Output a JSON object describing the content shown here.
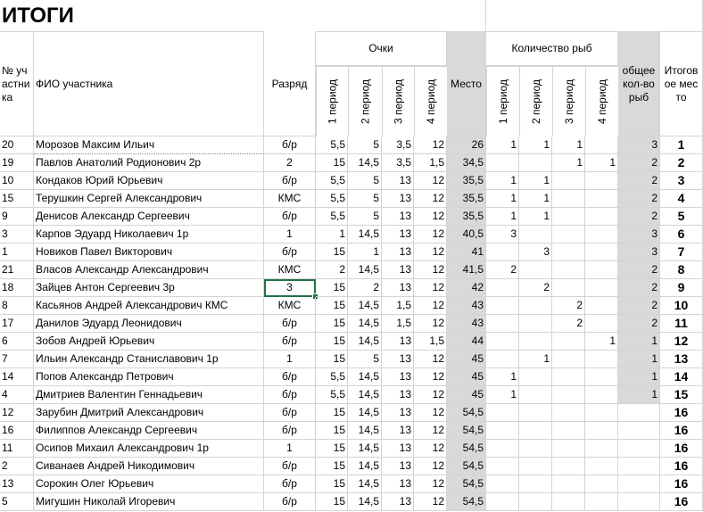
{
  "title": "ИТОГИ",
  "headers": {
    "num": "№ участника",
    "name": "ФИО участника",
    "rank": "Разряд",
    "points_group": "Очки",
    "points_cols": [
      "1 период",
      "2 период",
      "3 период",
      "4 период"
    ],
    "place": "Место",
    "fish_group": "Количество рыб",
    "fish_cols": [
      "1 период",
      "2 период",
      "3 период",
      "4 период"
    ],
    "total_fish": "общее кол-во рыб",
    "final_place": "Итоговое место"
  },
  "rows": [
    {
      "num": "20",
      "name": "Морозов Максим Ильич",
      "rank": "б/р",
      "p": [
        "5,5",
        "5",
        "3,5",
        "12"
      ],
      "place": "26",
      "f": [
        "1",
        "1",
        "1",
        ""
      ],
      "total": "3",
      "final": "1"
    },
    {
      "num": "19",
      "name": "Павлов Анатолий Родионович 2р",
      "rank": "2",
      "p": [
        "15",
        "14,5",
        "3,5",
        "1,5"
      ],
      "place": "34,5",
      "f": [
        "",
        "",
        "1",
        "1"
      ],
      "total": "2",
      "final": "2"
    },
    {
      "num": "10",
      "name": "Кондаков Юрий Юрьевич",
      "rank": "б/р",
      "p": [
        "5,5",
        "5",
        "13",
        "12"
      ],
      "place": "35,5",
      "f": [
        "1",
        "1",
        "",
        ""
      ],
      "total": "2",
      "final": "3"
    },
    {
      "num": "15",
      "name": "Терушкин Сергей Александрович",
      "rank": "КМС",
      "p": [
        "5,5",
        "5",
        "13",
        "12"
      ],
      "place": "35,5",
      "f": [
        "1",
        "1",
        "",
        ""
      ],
      "total": "2",
      "final": "4"
    },
    {
      "num": "9",
      "name": "Денисов Александр Сергеевич",
      "rank": "б/р",
      "p": [
        "5,5",
        "5",
        "13",
        "12"
      ],
      "place": "35,5",
      "f": [
        "1",
        "1",
        "",
        ""
      ],
      "total": "2",
      "final": "5"
    },
    {
      "num": "3",
      "name": "Карпов Эдуард Николаевич 1р",
      "rank": "1",
      "p": [
        "1",
        "14,5",
        "13",
        "12"
      ],
      "place": "40,5",
      "f": [
        "3",
        "",
        "",
        ""
      ],
      "total": "3",
      "final": "6"
    },
    {
      "num": "1",
      "name": "Новиков Павел Викторович",
      "rank": "б/р",
      "p": [
        "15",
        "1",
        "13",
        "12"
      ],
      "place": "41",
      "f": [
        "",
        "3",
        "",
        ""
      ],
      "total": "3",
      "final": "7"
    },
    {
      "num": "21",
      "name": "Власов Александр Александрович",
      "rank": "КМС",
      "p": [
        "2",
        "14,5",
        "13",
        "12"
      ],
      "place": "41,5",
      "f": [
        "2",
        "",
        "",
        ""
      ],
      "total": "2",
      "final": "8"
    },
    {
      "num": "18",
      "name": "Зайцев Антон Сергеевич 3р",
      "rank": "3",
      "p": [
        "15",
        "2",
        "13",
        "12"
      ],
      "place": "42",
      "f": [
        "",
        "2",
        "",
        ""
      ],
      "total": "2",
      "final": "9"
    },
    {
      "num": "8",
      "name": "Касьянов Андрей Александрович КМС",
      "rank": "КМС",
      "p": [
        "15",
        "14,5",
        "1,5",
        "12"
      ],
      "place": "43",
      "f": [
        "",
        "",
        "2",
        ""
      ],
      "total": "2",
      "final": "10"
    },
    {
      "num": "17",
      "name": "Данилов Эдуард Леонидович",
      "rank": "б/р",
      "p": [
        "15",
        "14,5",
        "1,5",
        "12"
      ],
      "place": "43",
      "f": [
        "",
        "",
        "2",
        ""
      ],
      "total": "2",
      "final": "11"
    },
    {
      "num": "6",
      "name": "Зобов Андрей Юрьевич",
      "rank": "б/р",
      "p": [
        "15",
        "14,5",
        "13",
        "1,5"
      ],
      "place": "44",
      "f": [
        "",
        "",
        "",
        "1"
      ],
      "total": "1",
      "final": "12"
    },
    {
      "num": "7",
      "name": "Ильин Александр Станиславович 1р",
      "rank": "1",
      "p": [
        "15",
        "5",
        "13",
        "12"
      ],
      "place": "45",
      "f": [
        "",
        "1",
        "",
        ""
      ],
      "total": "1",
      "final": "13"
    },
    {
      "num": "14",
      "name": "Попов Александр Петрович",
      "rank": "б/р",
      "p": [
        "5,5",
        "14,5",
        "13",
        "12"
      ],
      "place": "45",
      "f": [
        "1",
        "",
        "",
        ""
      ],
      "total": "1",
      "final": "14"
    },
    {
      "num": "4",
      "name": "Дмитриев Валентин Геннадьевич",
      "rank": "б/р",
      "p": [
        "5,5",
        "14,5",
        "13",
        "12"
      ],
      "place": "45",
      "f": [
        "1",
        "",
        "",
        ""
      ],
      "total": "1",
      "final": "15"
    },
    {
      "num": "12",
      "name": "Зарубин Дмитрий Александрович",
      "rank": "б/р",
      "p": [
        "15",
        "14,5",
        "13",
        "12"
      ],
      "place": "54,5",
      "f": [
        "",
        "",
        "",
        ""
      ],
      "total": "",
      "final": "16"
    },
    {
      "num": "16",
      "name": "Филиппов Александр Сергеевич",
      "rank": "б/р",
      "p": [
        "15",
        "14,5",
        "13",
        "12"
      ],
      "place": "54,5",
      "f": [
        "",
        "",
        "",
        ""
      ],
      "total": "",
      "final": "16"
    },
    {
      "num": "11",
      "name": "Осипов Михаил Александрович 1р",
      "rank": "1",
      "p": [
        "15",
        "14,5",
        "13",
        "12"
      ],
      "place": "54,5",
      "f": [
        "",
        "",
        "",
        ""
      ],
      "total": "",
      "final": "16"
    },
    {
      "num": "2",
      "name": "Сиванаев Андрей Никодимович",
      "rank": "б/р",
      "p": [
        "15",
        "14,5",
        "13",
        "12"
      ],
      "place": "54,5",
      "f": [
        "",
        "",
        "",
        ""
      ],
      "total": "",
      "final": "16"
    },
    {
      "num": "13",
      "name": "Сорокин Олег Юрьевич",
      "rank": "б/р",
      "p": [
        "15",
        "14,5",
        "13",
        "12"
      ],
      "place": "54,5",
      "f": [
        "",
        "",
        "",
        ""
      ],
      "total": "",
      "final": "16"
    },
    {
      "num": "5",
      "name": "Мигушин Николай Игоревич",
      "rank": "б/р",
      "p": [
        "15",
        "14,5",
        "13",
        "12"
      ],
      "place": "54,5",
      "f": [
        "",
        "",
        "",
        ""
      ],
      "total": "",
      "final": "16"
    }
  ]
}
